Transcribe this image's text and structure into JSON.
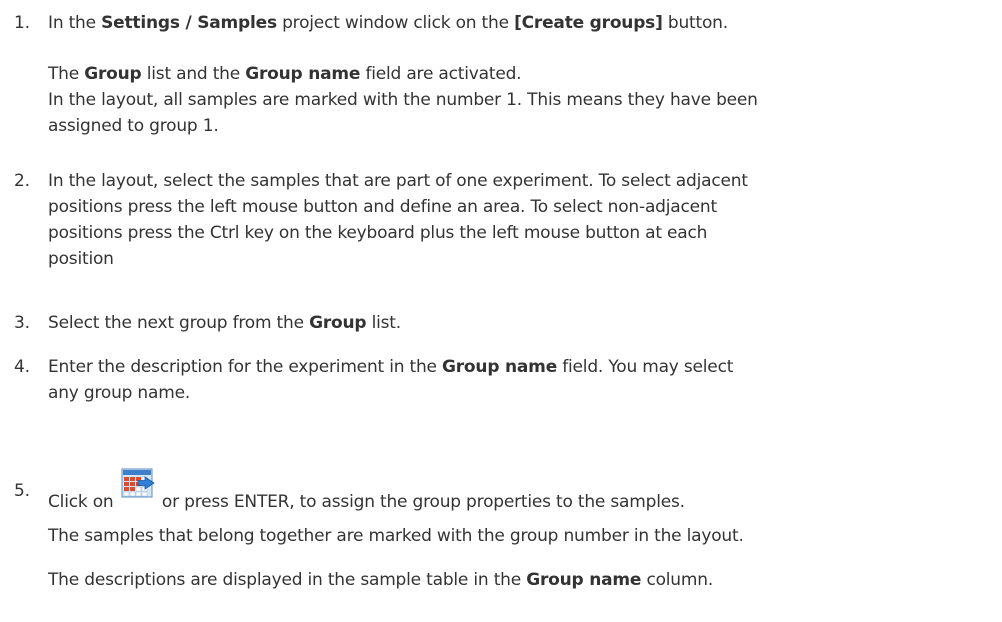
{
  "steps": [
    {
      "number": "1.",
      "text": {
        "a": "In the ",
        "b": "Settings / Samples",
        "c": " project window click on the ",
        "d": "[Create groups]",
        "e": " button."
      },
      "result": {
        "line1": {
          "a": "The ",
          "b": "Group",
          "c": " list and the ",
          "d": "Group name",
          "e": " field are activated."
        },
        "line2": "In the layout, all samples are marked with the number 1. This means they have been",
        "line3": "assigned to group 1."
      }
    },
    {
      "number": "2.",
      "lines": [
        "In the layout, select the samples that are part of one experiment. To select adjacent",
        "positions press the left mouse button and define an area. To select non-adjacent",
        "positions press the Ctrl key on the keyboard plus the left mouse button at each",
        "position"
      ]
    },
    {
      "number": "3.",
      "text": {
        "a": "Select the next group from the ",
        "b": "Group",
        "c": " list."
      }
    },
    {
      "number": "4.",
      "text": {
        "a": "Enter the description for the experiment in the ",
        "b": "Group name",
        "c": " field. You may select",
        "d": "any group name."
      }
    },
    {
      "number": "5.",
      "text": {
        "a": "Click on ",
        "icon": "assign-group-icon",
        "b": " or press ENTER, to assign the group properties to the samples."
      },
      "result1": "The samples that belong together are marked with the group number in the layout.",
      "result2": {
        "a": "The descriptions are displayed in the sample table in the ",
        "b": "Group name",
        "c": " column."
      }
    }
  ]
}
